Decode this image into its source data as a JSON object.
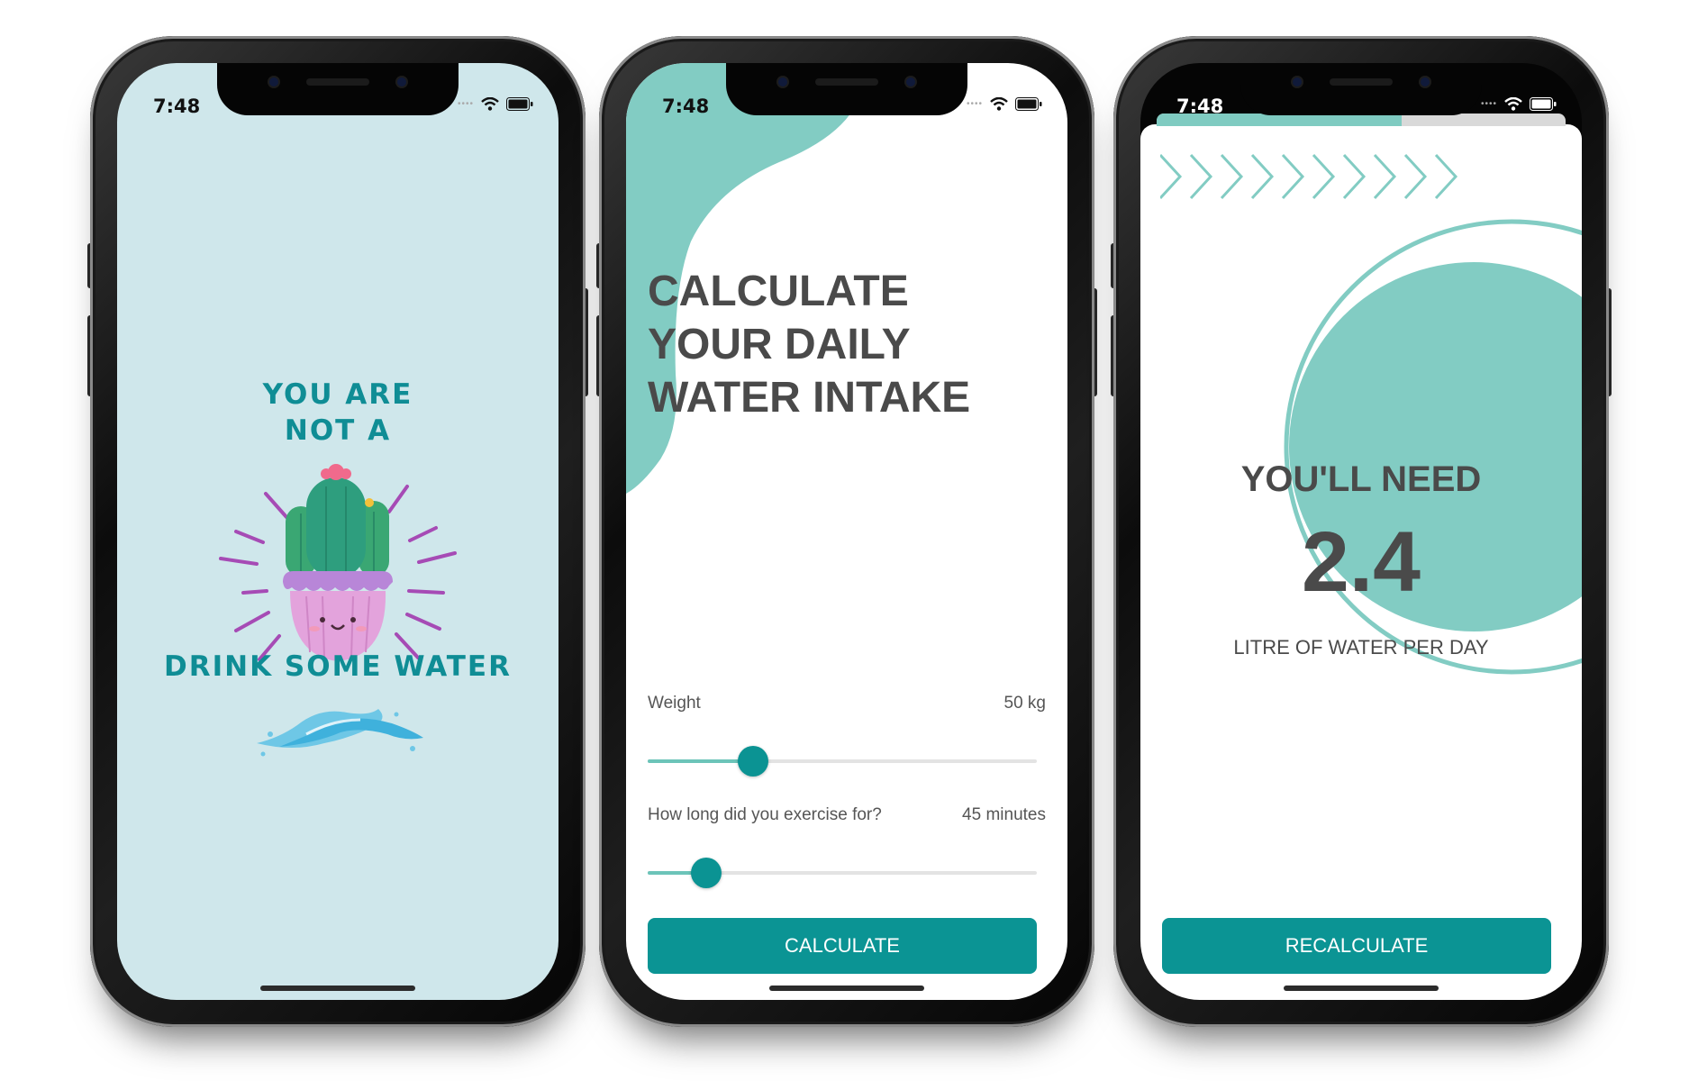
{
  "status_bar": {
    "time": "7:48"
  },
  "splash": {
    "line1": "YOU ARE",
    "line2": "NOT A",
    "line3": "DRINK SOME WATER",
    "colors": {
      "background": "#cfe7eb",
      "text": "#0f8d95",
      "cactus": "#2e9e7e",
      "pot": "#e3a3dc",
      "rays": "#a64bb5",
      "water": "#6ec7e6"
    }
  },
  "calculator": {
    "headline": "CALCULATE YOUR DAILY WATER INTAKE",
    "weight": {
      "label": "Weight",
      "value": "50 kg",
      "fraction": 0.27
    },
    "exercise": {
      "label": "How long did you exercise for?",
      "value": "45 minutes",
      "fraction": 0.15
    },
    "button": "CALCULATE",
    "colors": {
      "accent": "#0b9494",
      "blob": "#82ccc3"
    }
  },
  "result": {
    "title": "YOU'LL NEED",
    "amount": "2.4",
    "unit": "LITRE OF WATER PER DAY",
    "button": "RECALCULATE",
    "progress_fraction": 0.6,
    "colors": {
      "accent": "#0b9494",
      "circle": "#82ccc3"
    }
  }
}
